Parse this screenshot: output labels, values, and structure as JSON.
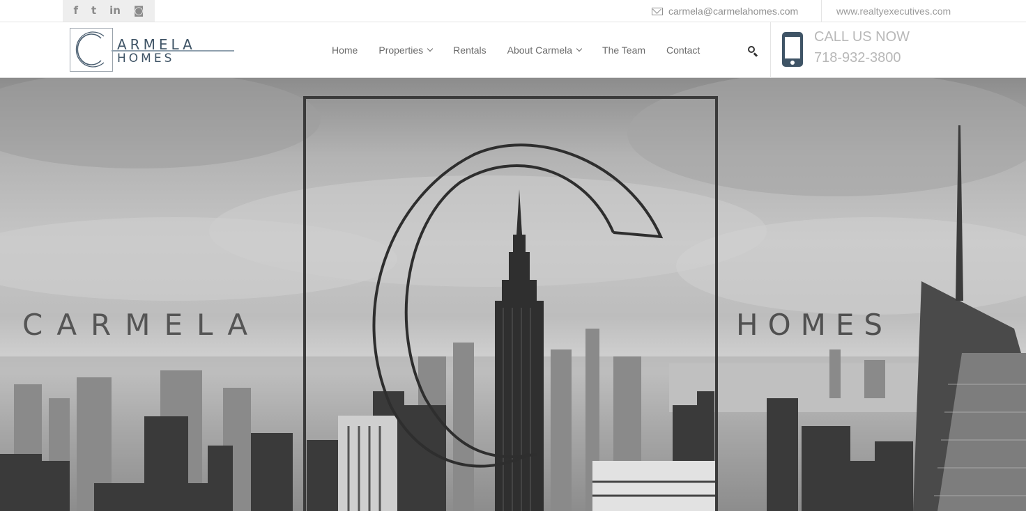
{
  "topbar": {
    "social": [
      {
        "name": "facebook-icon",
        "glyph": "f"
      },
      {
        "name": "twitter-icon",
        "glyph": "t"
      },
      {
        "name": "linkedin-icon",
        "glyph": "in"
      },
      {
        "name": "instagram-icon",
        "glyph": "◙"
      }
    ],
    "email": "carmela@carmelahomes.com",
    "website": "www.realtyexecutives.com"
  },
  "logo": {
    "line1": "ARMELA",
    "line2": "HOMES"
  },
  "nav": {
    "items": [
      {
        "label": "Home",
        "dropdown": false
      },
      {
        "label": "Properties",
        "dropdown": true
      },
      {
        "label": "Rentals",
        "dropdown": false
      },
      {
        "label": "About Carmela",
        "dropdown": true
      },
      {
        "label": "The Team",
        "dropdown": false
      },
      {
        "label": "Contact",
        "dropdown": false
      }
    ]
  },
  "contact": {
    "call_label": "CALL US NOW",
    "phone": "718-932-3800"
  },
  "hero": {
    "left_text": "CARMELA",
    "right_text": "HOMES"
  },
  "colors": {
    "brand": "#3f5466",
    "text_muted": "#8f8f8f"
  }
}
